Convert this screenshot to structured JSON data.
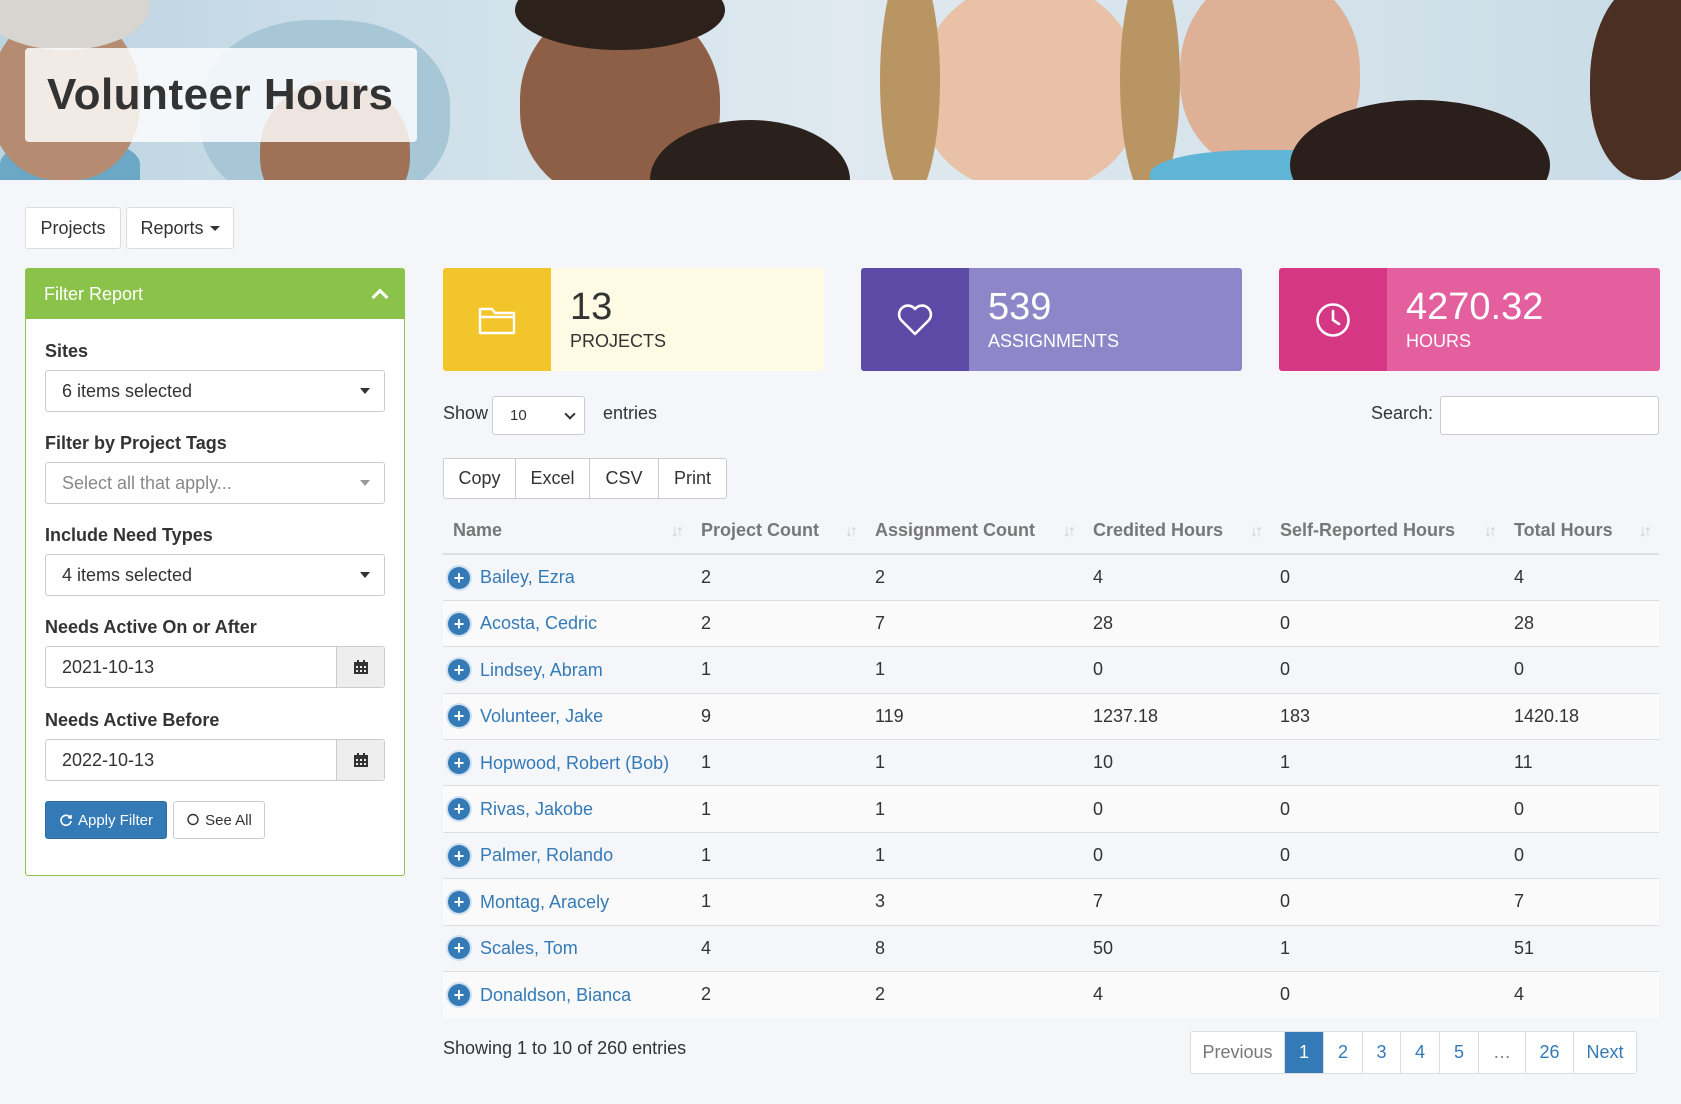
{
  "page": {
    "title": "Volunteer Hours"
  },
  "nav": {
    "projects": "Projects",
    "reports": "Reports"
  },
  "filter": {
    "header": "Filter Report",
    "sites_label": "Sites",
    "sites_value": "6 items selected",
    "tags_label": "Filter by Project Tags",
    "tags_placeholder": "Select all that apply...",
    "needs_label": "Include Need Types",
    "needs_value": "4 items selected",
    "after_label": "Needs Active On or After",
    "after_value": "2021-10-13",
    "before_label": "Needs Active Before",
    "before_value": "2022-10-13",
    "apply": "Apply Filter",
    "see_all": "See All"
  },
  "stats": {
    "projects": {
      "value": "13",
      "label": "PROJECTS",
      "icon": "folder-icon"
    },
    "assignments": {
      "value": "539",
      "label": "ASSIGNMENTS",
      "icon": "heart-icon"
    },
    "hours": {
      "value": "4270.32",
      "label": "HOURS",
      "icon": "clock-icon"
    }
  },
  "controls": {
    "show": "Show",
    "entries": "entries",
    "page_length": "10",
    "search_label": "Search:",
    "search_value": ""
  },
  "export": {
    "copy": "Copy",
    "excel": "Excel",
    "csv": "CSV",
    "print": "Print"
  },
  "table": {
    "columns": [
      "Name",
      "Project Count",
      "Assignment Count",
      "Credited Hours",
      "Self-Reported Hours",
      "Total Hours"
    ],
    "rows": [
      [
        "Bailey, Ezra",
        "2",
        "2",
        "4",
        "0",
        "4"
      ],
      [
        "Acosta, Cedric",
        "2",
        "7",
        "28",
        "0",
        "28"
      ],
      [
        "Lindsey, Abram",
        "1",
        "1",
        "0",
        "0",
        "0"
      ],
      [
        "Volunteer, Jake",
        "9",
        "119",
        "1237.18",
        "183",
        "1420.18"
      ],
      [
        "Hopwood, Robert (Bob)",
        "1",
        "1",
        "10",
        "1",
        "11"
      ],
      [
        "Rivas, Jakobe",
        "1",
        "1",
        "0",
        "0",
        "0"
      ],
      [
        "Palmer, Rolando",
        "1",
        "1",
        "0",
        "0",
        "0"
      ],
      [
        "Montag, Aracely",
        "1",
        "3",
        "7",
        "0",
        "7"
      ],
      [
        "Scales, Tom",
        "4",
        "8",
        "50",
        "1",
        "51"
      ],
      [
        "Donaldson, Bianca",
        "2",
        "2",
        "4",
        "0",
        "4"
      ]
    ]
  },
  "info": "Showing 1 to 10 of 260 entries",
  "pagination": {
    "previous": "Previous",
    "pages": [
      "1",
      "2",
      "3",
      "4",
      "5",
      "…",
      "26"
    ],
    "active": "1",
    "next": "Next"
  },
  "colors": {
    "primary": "#337ab7",
    "filter_green": "#8bc34a",
    "projects_icon_bg": "#f2c52a",
    "projects_body_bg": "#fefae3",
    "assignments_icon_bg": "#5b4aa6",
    "assignments_body_bg": "#8e86c8",
    "hours_icon_bg": "#d63784",
    "hours_body_bg": "#e35f9e"
  }
}
